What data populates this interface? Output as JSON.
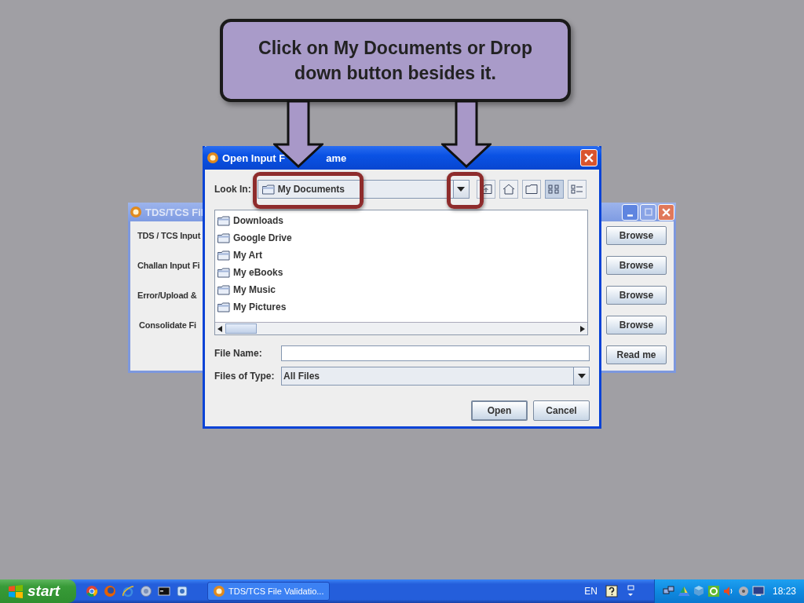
{
  "background_window": {
    "title": "TDS/TCS Fil",
    "rows": [
      {
        "label": "TDS / TCS Input",
        "button": "Browse"
      },
      {
        "label": "Challan Input Fi",
        "button": "Browse"
      },
      {
        "label": "Error/Upload &",
        "button": "Browse"
      },
      {
        "label": "Consolidate Fi",
        "button": "Browse"
      }
    ],
    "readme_button": "Read me"
  },
  "dialog": {
    "title_parts": [
      "Open Input F",
      "ame"
    ],
    "look_in_label": "Look In:",
    "look_in_value": "My Documents",
    "views": [
      {
        "kind": "list",
        "selected": true
      },
      {
        "kind": "details",
        "selected": false
      }
    ],
    "files": [
      "Downloads",
      "Google Drive",
      "My Art",
      "My eBooks",
      "My Music",
      "My Pictures"
    ],
    "file_name_label": "File Name:",
    "file_type_label": "Files of Type:",
    "file_type_value": "All Files",
    "buttons": [
      "Open",
      "Cancel"
    ]
  },
  "callout": {
    "text": "Click on My Documents or Drop down button besides it."
  },
  "taskbar": {
    "start": "start",
    "task": "TDS/TCS File Validatio...",
    "language": "EN",
    "clock": "18:23"
  }
}
